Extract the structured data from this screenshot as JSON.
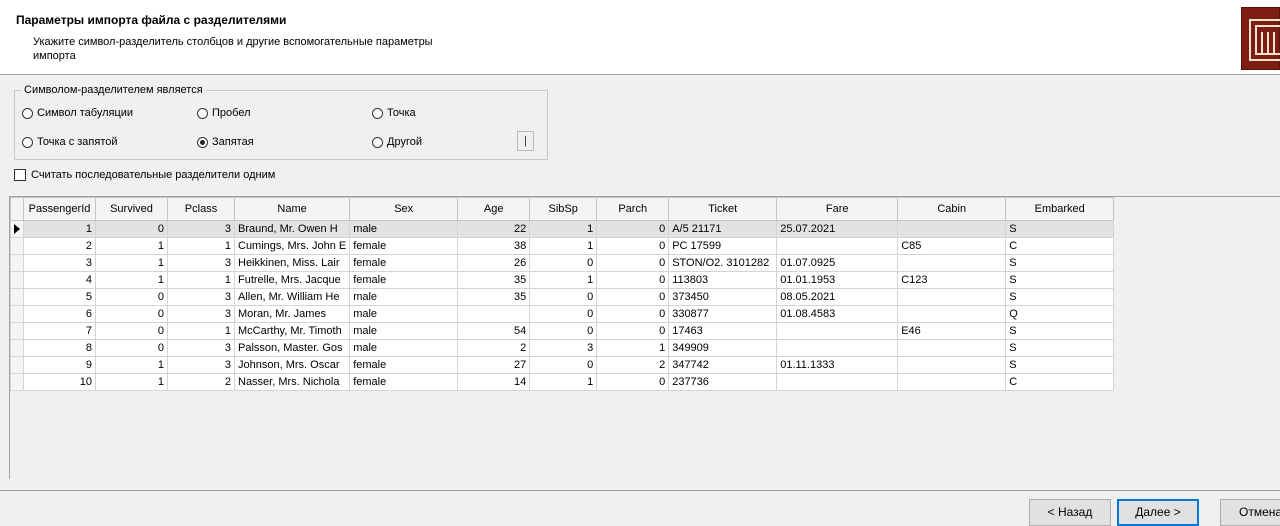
{
  "header": {
    "title": "Параметры импорта файла с разделителями",
    "subtitle": "Укажите символ-разделитель столбцов и другие вспомогательные параметры импорта",
    "logo_icon": "app-logo-icon"
  },
  "delimiter_group": {
    "legend": "Символом-разделителем является",
    "options": [
      {
        "label": "Символ табуляции",
        "checked": false
      },
      {
        "label": "Пробел",
        "checked": false
      },
      {
        "label": "Точка",
        "checked": false
      },
      {
        "label": "Точка с запятой",
        "checked": false
      },
      {
        "label": "Запятая",
        "checked": true
      },
      {
        "label": "Другой",
        "checked": false
      }
    ],
    "other_value": "|"
  },
  "consecutive": {
    "label": "Считать последовательные разделители одним",
    "checked": false
  },
  "grid": {
    "columns": [
      "PassengerId",
      "Survived",
      "Pclass",
      "Name",
      "Sex",
      "Age",
      "SibSp",
      "Parch",
      "Ticket",
      "Fare",
      "Cabin",
      "Embarked"
    ],
    "rows": [
      [
        "1",
        "0",
        "3",
        "Braund, Mr. Owen H",
        "male",
        "22",
        "1",
        "0",
        "A/5 21171",
        "25.07.2021",
        "",
        "S"
      ],
      [
        "2",
        "1",
        "1",
        "Cumings, Mrs. John E",
        "female",
        "38",
        "1",
        "0",
        "PC 17599",
        "",
        "C85",
        "C"
      ],
      [
        "3",
        "1",
        "3",
        "Heikkinen, Miss. Lair",
        "female",
        "26",
        "0",
        "0",
        "STON/O2. 3101282",
        "01.07.0925",
        "",
        "S"
      ],
      [
        "4",
        "1",
        "1",
        "Futrelle, Mrs. Jacque",
        "female",
        "35",
        "1",
        "0",
        "113803",
        "01.01.1953",
        "C123",
        "S"
      ],
      [
        "5",
        "0",
        "3",
        "Allen, Mr. William He",
        "male",
        "35",
        "0",
        "0",
        "373450",
        "08.05.2021",
        "",
        "S"
      ],
      [
        "6",
        "0",
        "3",
        "Moran, Mr. James",
        "male",
        "",
        "0",
        "0",
        "330877",
        "01.08.4583",
        "",
        "Q"
      ],
      [
        "7",
        "0",
        "1",
        "McCarthy, Mr. Timoth",
        "male",
        "54",
        "0",
        "0",
        "17463",
        "",
        "E46",
        "S"
      ],
      [
        "8",
        "0",
        "3",
        "Palsson, Master. Gos",
        "male",
        "2",
        "3",
        "1",
        "349909",
        "",
        "",
        "S"
      ],
      [
        "9",
        "1",
        "3",
        "Johnson, Mrs. Oscar",
        "female",
        "27",
        "0",
        "2",
        "347742",
        "01.11.1333",
        "",
        "S"
      ],
      [
        "10",
        "1",
        "2",
        "Nasser, Mrs. Nichola",
        "female",
        "14",
        "1",
        "0",
        "237736",
        "",
        "",
        "C"
      ]
    ],
    "selected_row": 0
  },
  "buttons": {
    "back": "< Назад",
    "next": "Далее >",
    "cancel": "Отмена"
  }
}
